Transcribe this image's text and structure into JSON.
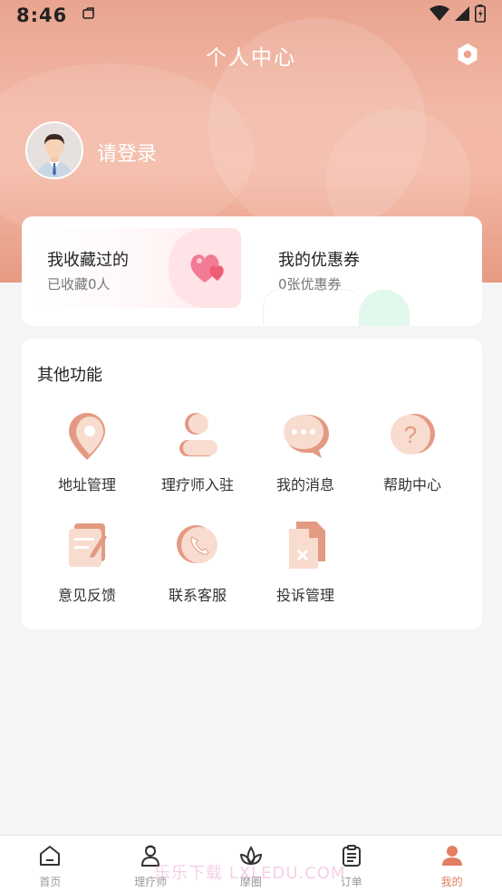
{
  "status_bar": {
    "time": "8:46",
    "icons": [
      "photo-icon",
      "wifi-icon",
      "signal-icon",
      "battery-icon"
    ]
  },
  "header": {
    "title": "个人中心",
    "settings_icon": "hexagon-settings-icon",
    "login_text": "请登录"
  },
  "summary": {
    "favorites": {
      "title": "我收藏过的",
      "subtitle": "已收藏0人"
    },
    "coupons": {
      "title": "我的优惠券",
      "subtitle": "0张优惠券"
    }
  },
  "functions": {
    "title": "其他功能",
    "items": [
      {
        "label": "地址管理",
        "icon": "location-pin-icon"
      },
      {
        "label": "理疗师入驻",
        "icon": "person-icon"
      },
      {
        "label": "我的消息",
        "icon": "message-bubble-icon"
      },
      {
        "label": "帮助中心",
        "icon": "question-icon"
      },
      {
        "label": "意见反馈",
        "icon": "edit-note-icon"
      },
      {
        "label": "联系客服",
        "icon": "phone-icon"
      },
      {
        "label": "投诉管理",
        "icon": "document-x-icon"
      }
    ]
  },
  "bottom_nav": {
    "items": [
      {
        "label": "首页",
        "icon": "home-icon"
      },
      {
        "label": "理疗师",
        "icon": "therapist-icon"
      },
      {
        "label": "摩圈",
        "icon": "lotus-icon"
      },
      {
        "label": "订单",
        "icon": "clipboard-icon"
      },
      {
        "label": "我的",
        "icon": "user-icon"
      }
    ],
    "active_index": 4
  },
  "watermark": "乐乐下载 LXLEDU.COM",
  "colors": {
    "accent": "#e27e62",
    "header_top": "#e9a48f",
    "header_bottom": "#e79a82",
    "icon_light": "#f6d4c8",
    "icon_dark": "#e08f77"
  }
}
